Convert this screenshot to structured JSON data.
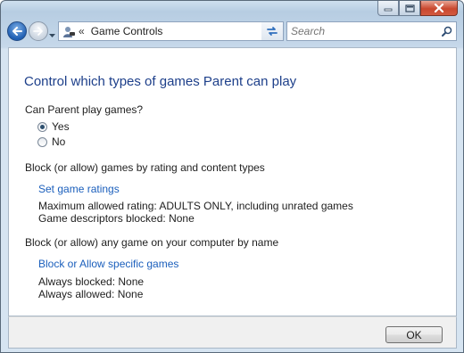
{
  "toolbar": {
    "address": {
      "chevron": "«",
      "crumb": "Game Controls"
    },
    "search": {
      "placeholder": "Search"
    }
  },
  "main": {
    "heading": "Control which types of games Parent can play",
    "question": "Can Parent play games?",
    "options": [
      {
        "label": "Yes",
        "checked": true
      },
      {
        "label": "No",
        "checked": false
      }
    ],
    "rating_section": {
      "title": "Block (or allow) games by rating and content types",
      "link": "Set game ratings",
      "max_rating": "Maximum allowed rating:  ADULTS ONLY, including unrated games",
      "descriptors": "Game descriptors blocked:  None"
    },
    "name_section": {
      "title": "Block (or allow) any game on your computer by name",
      "link": "Block or Allow specific games",
      "always_blocked": "Always blocked:  None",
      "always_allowed": "Always allowed:  None"
    }
  },
  "footer": {
    "ok_label": "OK"
  },
  "colors": {
    "heading": "#1d3f8a",
    "link": "#1b5fbc",
    "close_button": "#c9482f"
  }
}
